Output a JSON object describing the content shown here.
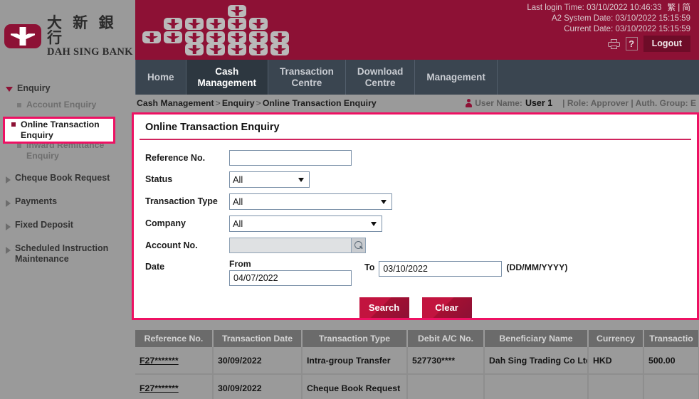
{
  "brand": {
    "logo_cn": "大 新 銀 行",
    "logo_en": "DAH SING BANK",
    "logo_icon": "dah-sing-logo"
  },
  "header": {
    "last_login": "Last login Time: 03/10/2022 10:46:33",
    "system_date": "A2 System Date: 03/10/2022 15:15:59",
    "current_date": "Current Date: 03/10/2022 15:15:59",
    "lang_trad": "繁",
    "lang_divider": "|",
    "lang_simp": "简",
    "print_icon": "printer-icon",
    "help_label": "?",
    "logout_label": "Logout"
  },
  "tabs": [
    {
      "label": "Home",
      "active": false
    },
    {
      "label": "Cash\nManagement",
      "active": true
    },
    {
      "label": "Transaction\nCentre",
      "active": false
    },
    {
      "label": "Download\nCentre",
      "active": false
    },
    {
      "label": "Management",
      "active": false
    }
  ],
  "breadcrumb": {
    "root": "Cash Management",
    "sep1": ">",
    "mid": "Enquiry",
    "sep2": ">",
    "current": "Online Transaction Enquiry"
  },
  "user": {
    "icon": "user-icon",
    "name_label": "User Name:",
    "name_value": "User 1",
    "role_info": "| Role: Approver | Auth. Group: E"
  },
  "sidebar": {
    "groups": [
      {
        "label": "Enquiry",
        "expanded": true,
        "items": [
          {
            "label": "Account Enquiry",
            "active": false
          },
          {
            "label": "Online Transaction Enquiry",
            "active": true
          },
          {
            "label": "Inward Remittance Enquiry",
            "active": false
          }
        ]
      },
      {
        "label": "Cheque Book Request",
        "expanded": false,
        "items": []
      },
      {
        "label": "Payments",
        "expanded": false,
        "items": []
      },
      {
        "label": "Fixed Deposit",
        "expanded": false,
        "items": []
      },
      {
        "label": "Scheduled Instruction Maintenance",
        "expanded": false,
        "items": []
      }
    ]
  },
  "panel": {
    "title": "Online Transaction Enquiry",
    "fields": {
      "reference_label": "Reference No.",
      "reference_value": "",
      "status_label": "Status",
      "status_value": "All",
      "txn_type_label": "Transaction Type",
      "txn_type_value": "All",
      "company_label": "Company",
      "company_value": "All",
      "account_label": "Account No.",
      "account_value": "",
      "account_lookup_icon": "magnifier-icon",
      "date_label": "Date",
      "from_label": "From",
      "from_value": "04/07/2022",
      "to_label": "To",
      "to_value": "03/10/2022",
      "format_hint": "(DD/MM/YYYY)"
    },
    "buttons": {
      "search_label": "Search",
      "clear_label": "Clear"
    }
  },
  "results": {
    "columns": [
      "Reference No.",
      "Transaction Date",
      "Transaction Type",
      "Debit A/C No.",
      "Beneficiary Name",
      "Currency",
      "Transactio"
    ],
    "rows": [
      {
        "reference": "F27*******",
        "date": "30/09/2022",
        "type": "Intra-group Transfer",
        "debit_ac": "527730****",
        "beneficiary": "Dah Sing Trading Co Ltd",
        "currency": "HKD",
        "amount": "500.00"
      },
      {
        "reference": "F27*******",
        "date": "30/09/2022",
        "type": "Cheque Book Request",
        "debit_ac": "",
        "beneficiary": "",
        "currency": "",
        "amount": ""
      }
    ]
  },
  "colors": {
    "brand_maroon": "#8d1135",
    "annotation_red": "#ee1163",
    "tab_bar": "#3a4550",
    "page_grey": "#9a9a9a",
    "table_header": "#6b6b6b"
  }
}
